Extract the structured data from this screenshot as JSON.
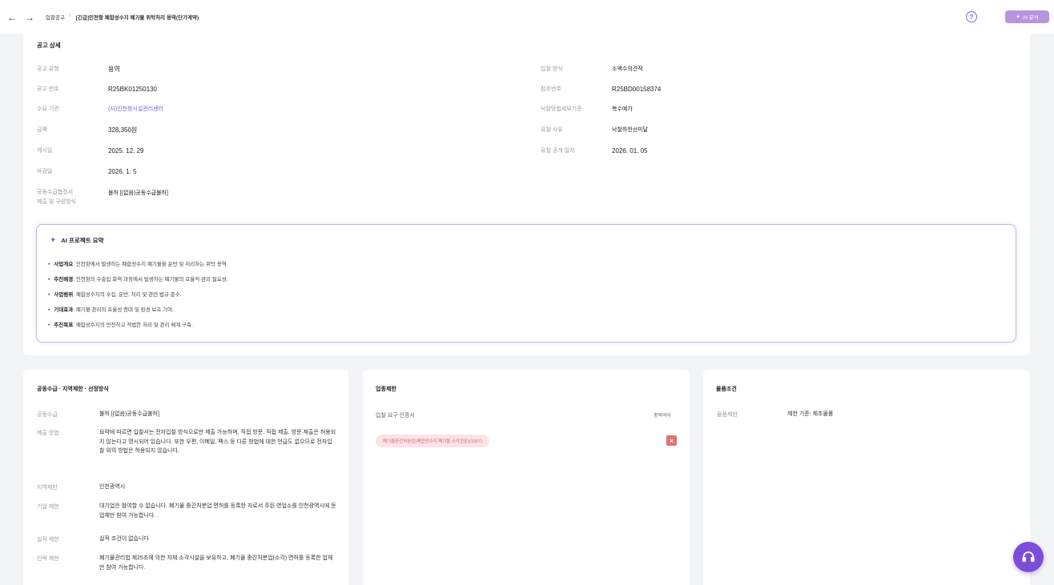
{
  "topbar": {
    "breadcrumb": [
      "입찰공고",
      "[긴급]인천항 폐합성수지 폐기물 위탁처리 용역(단가계약)"
    ],
    "ai_button_label": "AI 분석"
  },
  "detail": {
    "title": "공고 상세",
    "left_fields": [
      {
        "label": "공고 유형",
        "value": "용역"
      },
      {
        "label": "공고 번호",
        "value": "R25BK01250130"
      },
      {
        "label": "수요 기관",
        "value": "(사)인천항시설관리센터"
      },
      {
        "label": "금액",
        "value": "328,350원"
      },
      {
        "label": "게시일",
        "value": "2025. 12. 29"
      },
      {
        "label": "마감일",
        "value": "2026. 1. 5"
      },
      {
        "label": "공동수급협정서",
        "label2": "제출 및 구성방식",
        "value": "불허 [(없음)공동수급불허]"
      }
    ],
    "right_fields": [
      {
        "label": "입찰 방식",
        "value": "소액수의견적"
      },
      {
        "label": "참조번호",
        "value": "R25BD00158374"
      },
      {
        "label": "낙찰방법세부기준",
        "value": "복수예가"
      },
      {
        "label": "유찰 사유",
        "value": "낙찰하한선미달"
      },
      {
        "label": "유찰 공개 일자",
        "value": "2026. 01. 05"
      }
    ]
  },
  "ai_summary": {
    "title": "AI 프로젝트 요약",
    "items": [
      {
        "term": "사업개요",
        "text": ": 인천항에서 발생하는 폐합성수지 폐기물을 운반 및 처리하는 위탁 용역."
      },
      {
        "term": "추진배경",
        "text": ": 인천항의 수출입 화역 과정에서 발생하는 폐기물의 효율적 관리 필요성."
      },
      {
        "term": "사업범위",
        "text": ": 폐합성수지의 수집, 운반, 처리 및 관련 법규 준수."
      },
      {
        "term": "기대효과",
        "text": ": 폐기물 관리의 효율성 증대 및 환경 보호 기여."
      },
      {
        "term": "추진목표",
        "text": ": 폐합성수지의 안전하고 적법한 처리 및 관리 체계 구축."
      }
    ]
  },
  "joint": {
    "title": "공동수급 · 지역제한 · 선정방식",
    "rows": [
      {
        "label": "공동수급",
        "value": "불허 [(없음)공동수급불허]"
      },
      {
        "label": "제출 방법",
        "value": "요약에 따르면 입찰서는 전자입찰 방식으로만 제출 가능하며, 직접 방문, 직접 제출, 방문 제출은 허용되지 않는다고 명시되어 있습니다. 또한 우편, 이메일, 팩스 등 다른 방법에 대한 언급도 없으므로 전자입찰 외의 방법은 허용되지 않습니다."
      },
      {
        "label": "지역제한",
        "value": "인천광역시"
      },
      {
        "label": "기업 제한",
        "value": "대기업은 참여할 수 없습니다. 폐기물 중간처분업 면허를 등록한 자로서 주된 영업소를 인천광역시에 둔 업체만 참여 가능합니다."
      },
      {
        "label": "실적 제한",
        "value": "실적 조건이 없습니다"
      },
      {
        "label": "인력 제한",
        "value": "폐기물관리법 제25조에 의한 자체 소각시설을 보유하고, 폐기물 중간처분업(소각) 면허를 등록한 업체만 참여 가능합니다."
      }
    ]
  },
  "license": {
    "title": "업종제한",
    "required_label": "입찰 요구 인증서",
    "duplicate_label": "중복여부",
    "tags": [
      "폐기물중간처분업(폐합성수지 폐기물 소각전문)(1007)"
    ]
  },
  "product": {
    "title": "물품조건",
    "label": "물품제한",
    "value": "제한 기준: 제조물품"
  },
  "icons": {
    "back": "arrow-left-icon",
    "forward": "arrow-right-icon",
    "help": "help-circle-icon",
    "ai": "sparkle-icon",
    "remove": "close-icon",
    "chat": "headset-icon"
  },
  "colors": {
    "accent": "#8b5cf6",
    "ai_button": "#b794e0",
    "tag_bg": "#fbe3e6",
    "tag_text": "#d7636e",
    "remove_button": "#e56f73",
    "link": "#7c5cd6"
  }
}
